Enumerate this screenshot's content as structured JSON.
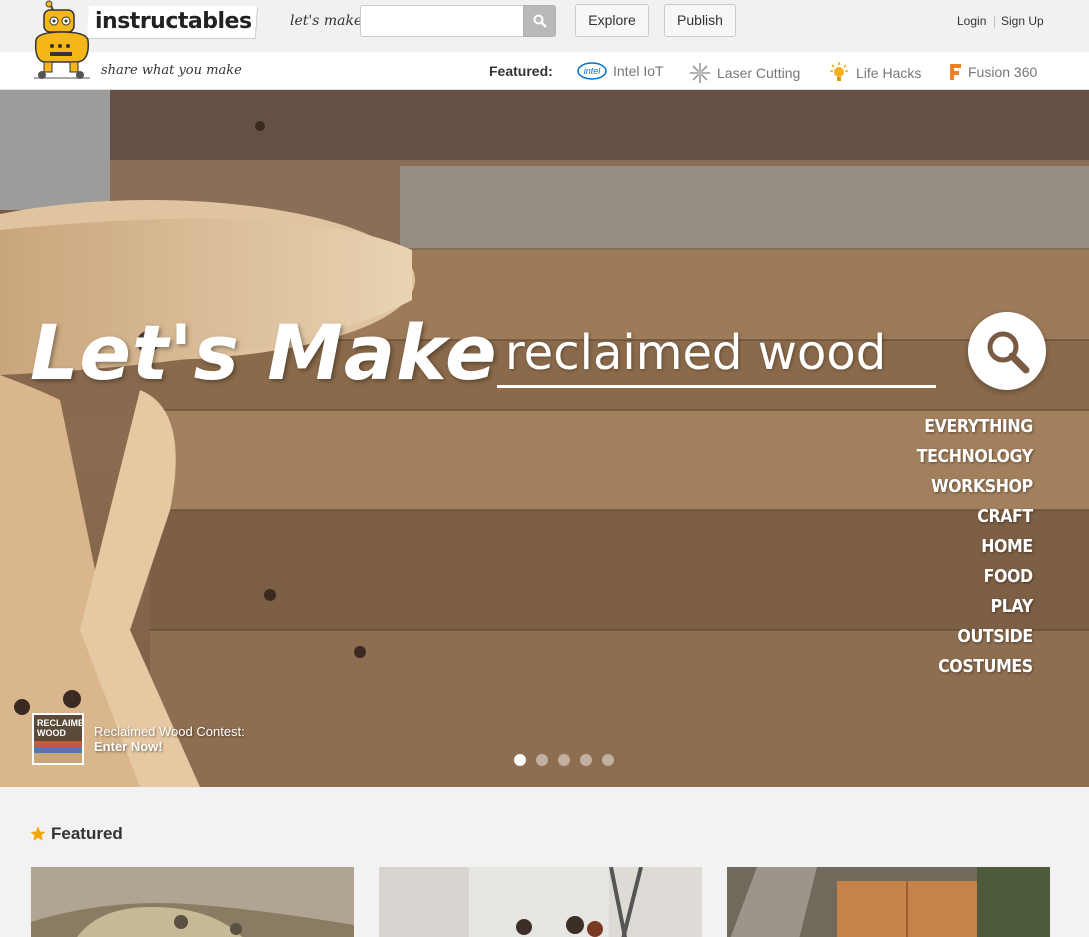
{
  "header": {
    "brand": "instructables",
    "tagline": "share what you make",
    "lets_make": "let's make",
    "search_placeholder": "",
    "explore": "Explore",
    "publish": "Publish",
    "login": "Login",
    "separator": "|",
    "signup": "Sign Up"
  },
  "featured_bar": {
    "label": "Featured:",
    "items": [
      {
        "label": "Intel IoT",
        "icon": "intel-logo-icon"
      },
      {
        "label": "Laser Cutting",
        "icon": "laser-icon"
      },
      {
        "label": "Life Hacks",
        "icon": "lightbulb-icon"
      },
      {
        "label": "Fusion 360",
        "icon": "fusion-icon"
      }
    ]
  },
  "hero": {
    "headline": "Let's Make",
    "search_value": "reclaimed wood",
    "categories": [
      "EVERYTHING",
      "TECHNOLOGY",
      "WORKSHOP",
      "CRAFT",
      "HOME",
      "FOOD",
      "PLAY",
      "OUTSIDE",
      "COSTUMES"
    ],
    "contest": {
      "thumb_label_1": "RECLAIMED",
      "thumb_label_2": "WOOD",
      "title": "Reclaimed Wood Contest:",
      "cta": "Enter Now!"
    },
    "slides_total": 5,
    "slide_active": 1
  },
  "featured_section": {
    "title": "Featured"
  },
  "colors": {
    "brand_yellow": "#f4b618",
    "star": "#f0a800",
    "hero_wood": "#8a6a4c"
  }
}
